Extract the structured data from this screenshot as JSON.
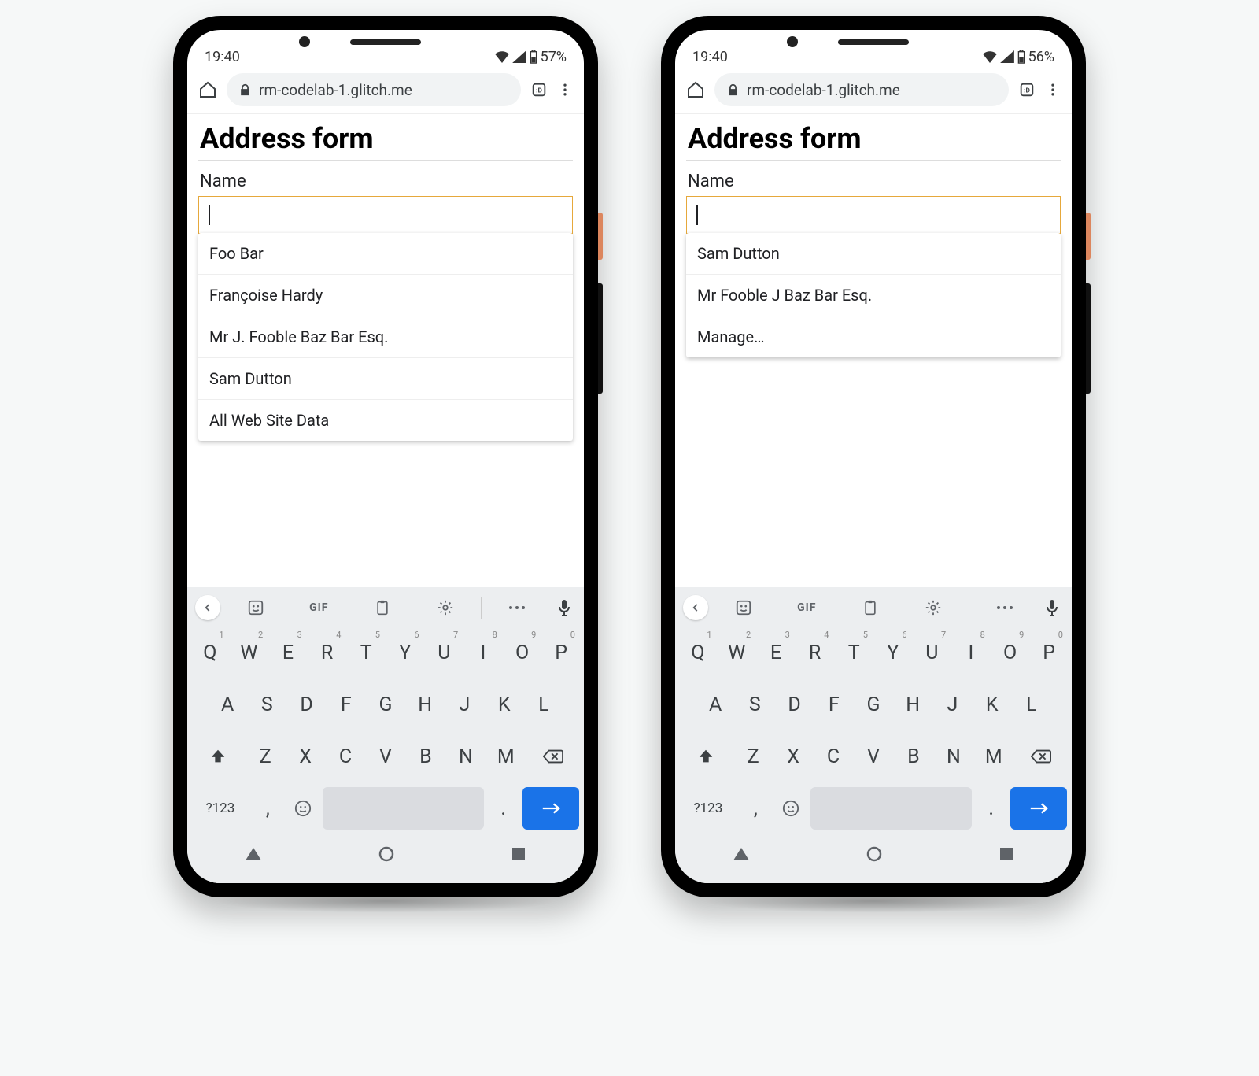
{
  "phones": [
    {
      "status": {
        "time": "19:40",
        "battery": "57%"
      },
      "url": "rm-codelab-1.glitch.me",
      "page": {
        "title": "Address form",
        "label": "Name",
        "input_value": "",
        "suggestions": [
          "Foo Bar",
          "Françoise Hardy",
          "Mr J. Fooble Baz Bar Esq.",
          "Sam Dutton",
          "All Web Site Data"
        ]
      }
    },
    {
      "status": {
        "time": "19:40",
        "battery": "56%"
      },
      "url": "rm-codelab-1.glitch.me",
      "page": {
        "title": "Address form",
        "label": "Name",
        "input_value": "",
        "suggestions": [
          "Sam Dutton",
          "Mr Fooble J Baz Bar Esq.",
          "Manage…"
        ]
      }
    }
  ],
  "keyboard": {
    "toolbar_gif": "GIF",
    "row1": [
      {
        "k": "Q",
        "s": "1"
      },
      {
        "k": "W",
        "s": "2"
      },
      {
        "k": "E",
        "s": "3"
      },
      {
        "k": "R",
        "s": "4"
      },
      {
        "k": "T",
        "s": "5"
      },
      {
        "k": "Y",
        "s": "6"
      },
      {
        "k": "U",
        "s": "7"
      },
      {
        "k": "I",
        "s": "8"
      },
      {
        "k": "O",
        "s": "9"
      },
      {
        "k": "P",
        "s": "0"
      }
    ],
    "row2": [
      "A",
      "S",
      "D",
      "F",
      "G",
      "H",
      "J",
      "K",
      "L"
    ],
    "row3": [
      "Z",
      "X",
      "C",
      "V",
      "B",
      "N",
      "M"
    ],
    "row4_sym": "?123",
    "row4_comma": ",",
    "row4_period": "."
  }
}
